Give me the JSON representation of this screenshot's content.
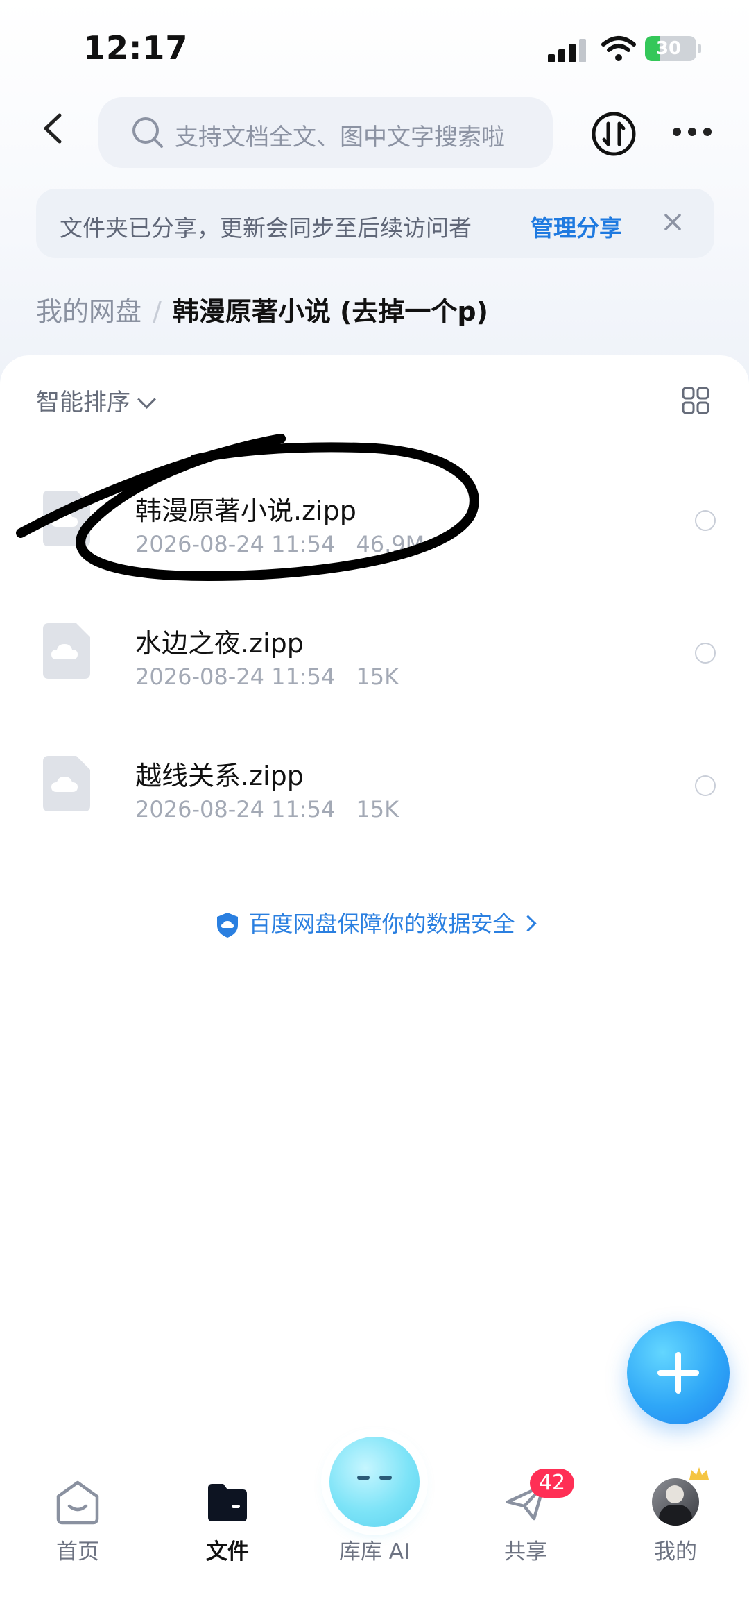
{
  "status_bar": {
    "time": "12:17",
    "battery_percent": 30,
    "battery_label": "30"
  },
  "header": {
    "search_placeholder": "支持文档全文、图中文字搜索啦",
    "icons": [
      "back-arrow-icon",
      "search-icon",
      "transfer-icon",
      "more-icon"
    ]
  },
  "share_notice": {
    "message": "文件夹已分享，更新会同步至后续访问者",
    "action": "管理分享",
    "link_color": "#1f7ae0"
  },
  "breadcrumb": {
    "root": "我的网盘",
    "separator": "/",
    "current": "韩漫原著小说 (去掉一个p)"
  },
  "list_header": {
    "sort_label": "智能排序"
  },
  "files": [
    {
      "name": "韩漫原著小说.zipp",
      "date": "2026-08-24 11:54",
      "size": "46.9M"
    },
    {
      "name": "水边之夜.zipp",
      "date": "2026-08-24 11:54",
      "size": "15K"
    },
    {
      "name": "越线关系.zipp",
      "date": "2026-08-24 11:54",
      "size": "15K"
    }
  ],
  "safety_note": "百度网盘保障你的数据安全",
  "bottom_nav": {
    "items": [
      {
        "label": "首页",
        "icon": "home-icon"
      },
      {
        "label": "文件",
        "icon": "folder-icon",
        "active": true
      },
      {
        "label": "库库 AI",
        "icon": "ai-assistant-icon"
      },
      {
        "label": "共享",
        "icon": "share-plane-icon",
        "badge": "42"
      },
      {
        "label": "我的",
        "icon": "avatar"
      }
    ]
  },
  "colors": {
    "accent": "#1f7ae0",
    "badge": "#ff2f55",
    "fab": "#2fa7f7"
  }
}
